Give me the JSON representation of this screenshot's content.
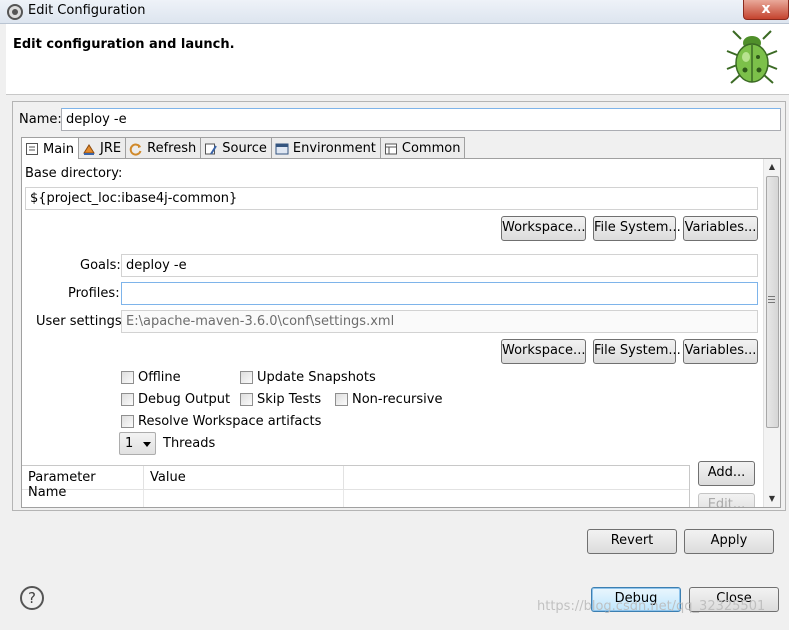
{
  "window": {
    "title": "Edit Configuration",
    "close_glyph": "x"
  },
  "header": {
    "heading": "Edit configuration and launch.",
    "icon": "debug-bug-icon"
  },
  "name": {
    "label": "Name:",
    "value": "deploy -e"
  },
  "tabs": [
    {
      "label": "Main",
      "icon": "main-tab-icon"
    },
    {
      "label": "JRE",
      "icon": "jre-icon"
    },
    {
      "label": "Refresh",
      "icon": "refresh-icon"
    },
    {
      "label": "Source",
      "icon": "source-icon"
    },
    {
      "label": "Environment",
      "icon": "environment-icon"
    },
    {
      "label": "Common",
      "icon": "common-icon"
    }
  ],
  "main": {
    "base_directory_label": "Base directory:",
    "base_directory_value": "${project_loc:ibase4j-common}",
    "workspace_button": "Workspace...",
    "filesystem_button": "File System...",
    "variables_button": "Variables...",
    "goals_label": "Goals:",
    "goals_value": "deploy -e",
    "profiles_label": "Profiles:",
    "profiles_value": "",
    "user_settings_label": "User settings:",
    "user_settings_value": "E:\\apache-maven-3.6.0\\conf\\settings.xml",
    "checkboxes": {
      "offline": "Offline",
      "update_snapshots": "Update Snapshots",
      "debug_output": "Debug Output",
      "skip_tests": "Skip Tests",
      "non_recursive": "Non-recursive",
      "resolve_workspace": "Resolve Workspace artifacts"
    },
    "threads_value": "1",
    "threads_label": "Threads",
    "param_table": {
      "col_name": "Parameter Name",
      "col_value": "Value"
    },
    "add_button": "Add...",
    "edit_button": "Edit..."
  },
  "footer": {
    "revert": "Revert",
    "apply": "Apply",
    "debug": "Debug",
    "close": "Close",
    "help": "?"
  },
  "watermark": "https://blog.csdn.net/qq_32325501"
}
